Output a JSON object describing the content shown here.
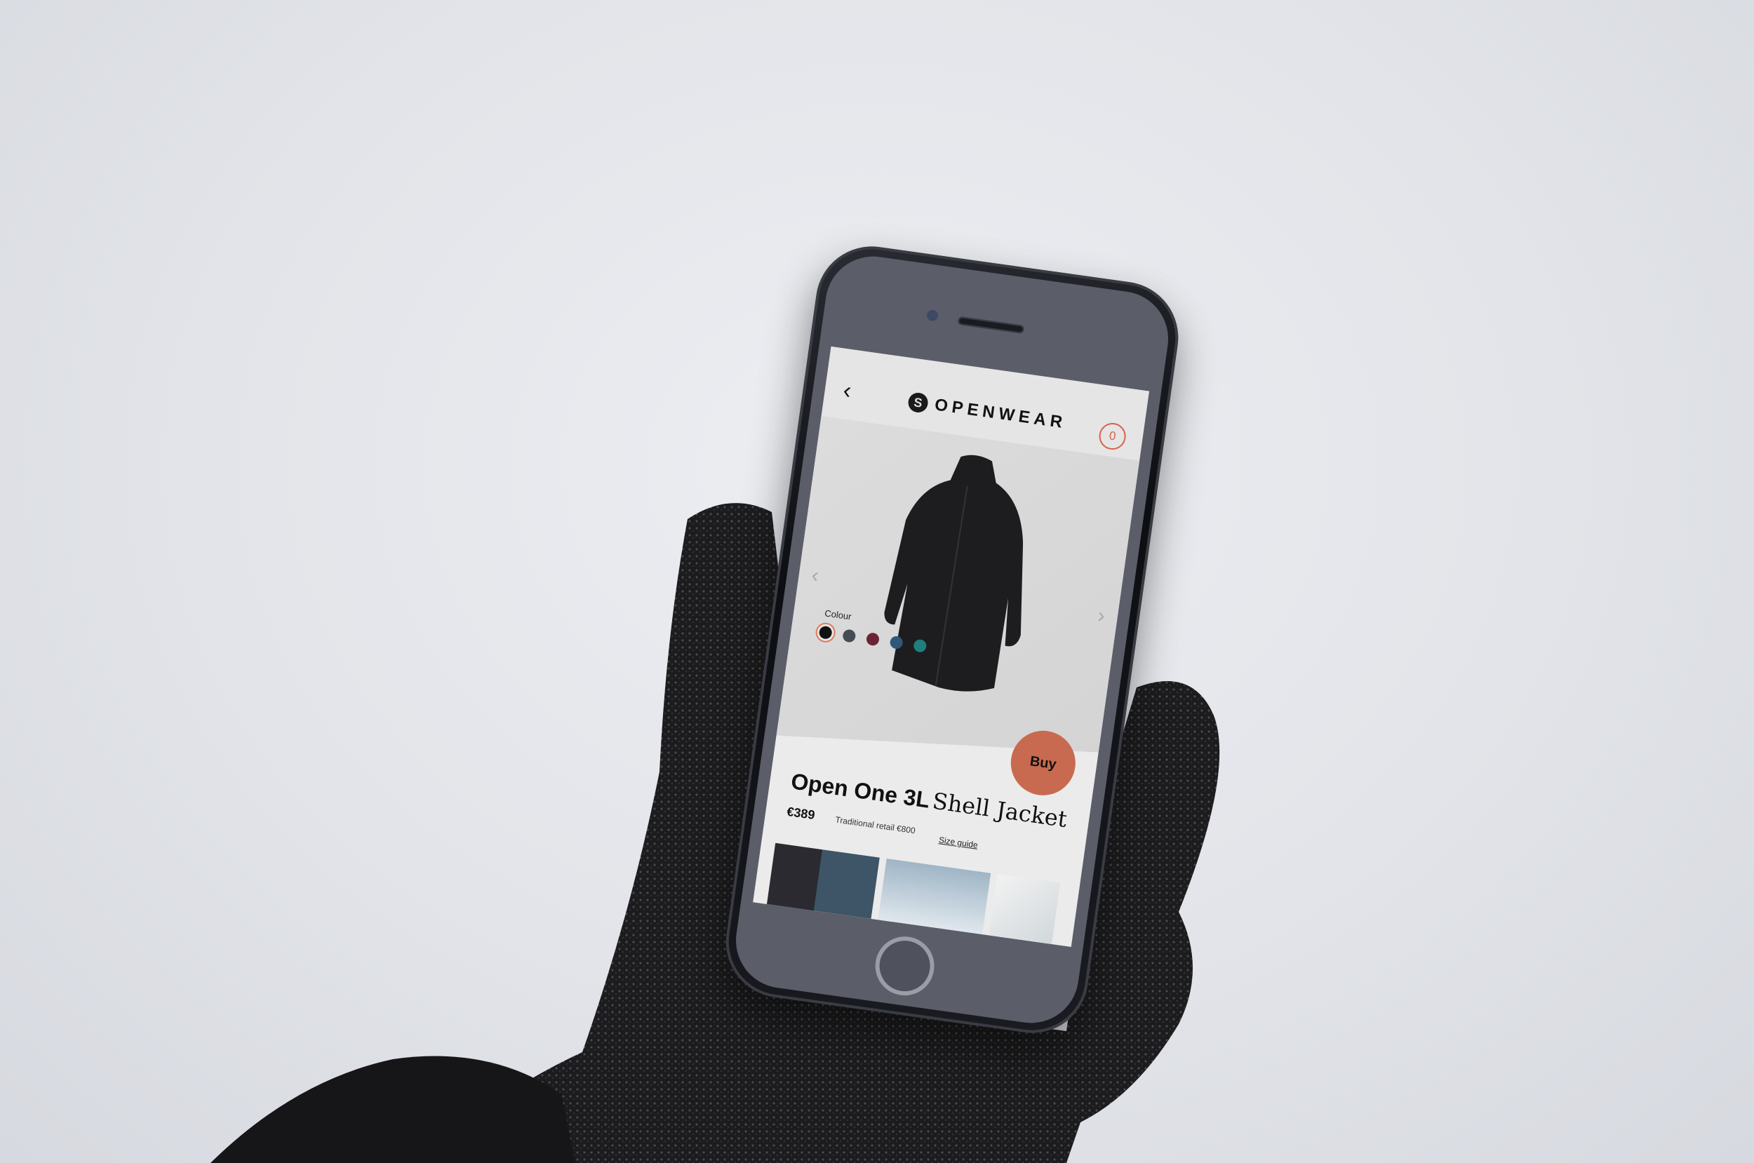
{
  "app": {
    "brand": "OPENWEAR",
    "cart_count": "0",
    "back_icon": "chevron-left-icon",
    "prev_icon": "chevron-left-icon",
    "next_icon": "chevron-right-icon"
  },
  "product": {
    "colour_label": "Colour",
    "colours": [
      "#111111",
      "#474b55",
      "#6b2436",
      "#2f587a",
      "#1f7f7c"
    ],
    "selected_colour_index": 0,
    "title_bold": "Open One 3L",
    "title_serif": "Shell Jacket",
    "price": "€389",
    "retail": "Traditional retail €800",
    "size_guide": "Size guide",
    "buy_label": "Buy"
  },
  "colors": {
    "accent": "#c86a4f",
    "cart": "#d9604a"
  }
}
